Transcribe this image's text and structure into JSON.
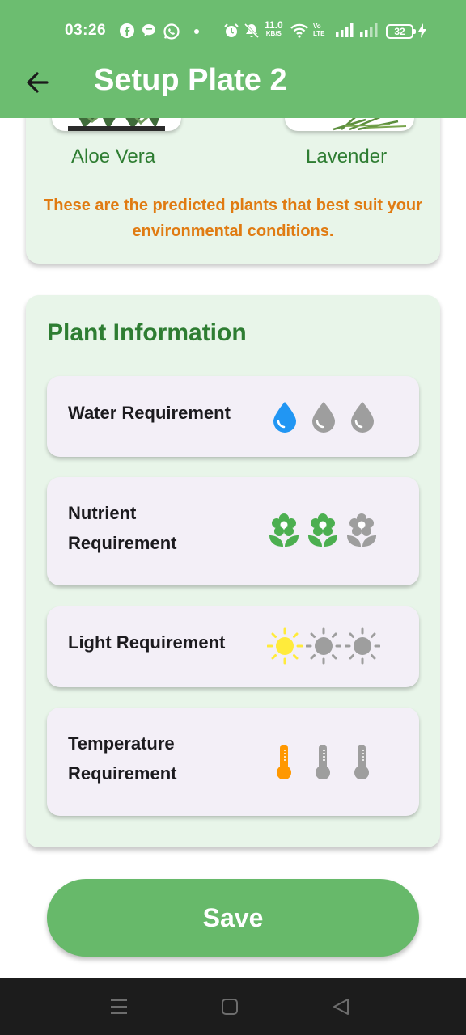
{
  "status_bar": {
    "time": "03:26",
    "net_speed_value": "11.0",
    "net_speed_unit": "KB/S",
    "volte_top": "Vo",
    "volte_bottom": "LTE",
    "battery": "32",
    "icons": [
      "facebook-icon",
      "chat-icon",
      "whatsapp-icon",
      "dot-icon",
      "alarm-icon",
      "mute-icon",
      "wifi-icon",
      "signal-icon",
      "signal-icon",
      "charging-icon"
    ]
  },
  "app_bar": {
    "back_icon": "arrow-left-icon",
    "title": "Setup Plate 2",
    "color": "#6cbd70"
  },
  "predictions": {
    "plants": [
      {
        "name": "Aloe Vera"
      },
      {
        "name": "Lavender"
      }
    ],
    "note": "These are the predicted plants that best suit your environmental conditions."
  },
  "plant_info": {
    "title": "Plant Information",
    "requirements": [
      {
        "label_line1": "Water Requirement",
        "label_line2": "",
        "icon": "water-drop-icon",
        "level": 1,
        "max": 3,
        "active_color": "#2196f3"
      },
      {
        "label_line1": "Nutrient",
        "label_line2": "Requirement",
        "icon": "flower-icon",
        "level": 2,
        "max": 3,
        "active_color": "#4caf50"
      },
      {
        "label_line1": "Light Requirement",
        "label_line2": "",
        "icon": "sun-icon",
        "level": 1,
        "max": 3,
        "active_color": "#ffeb3b"
      },
      {
        "label_line1": "Temperature",
        "label_line2": "Requirement",
        "icon": "thermometer-icon",
        "level": 1,
        "max": 3,
        "active_color": "#ff9800"
      }
    ],
    "inactive_color": "#9e9e9e"
  },
  "save_button": {
    "label": "Save"
  },
  "nav_bar": {
    "icons": [
      "menu-icon",
      "home-icon",
      "back-triangle-icon"
    ]
  }
}
